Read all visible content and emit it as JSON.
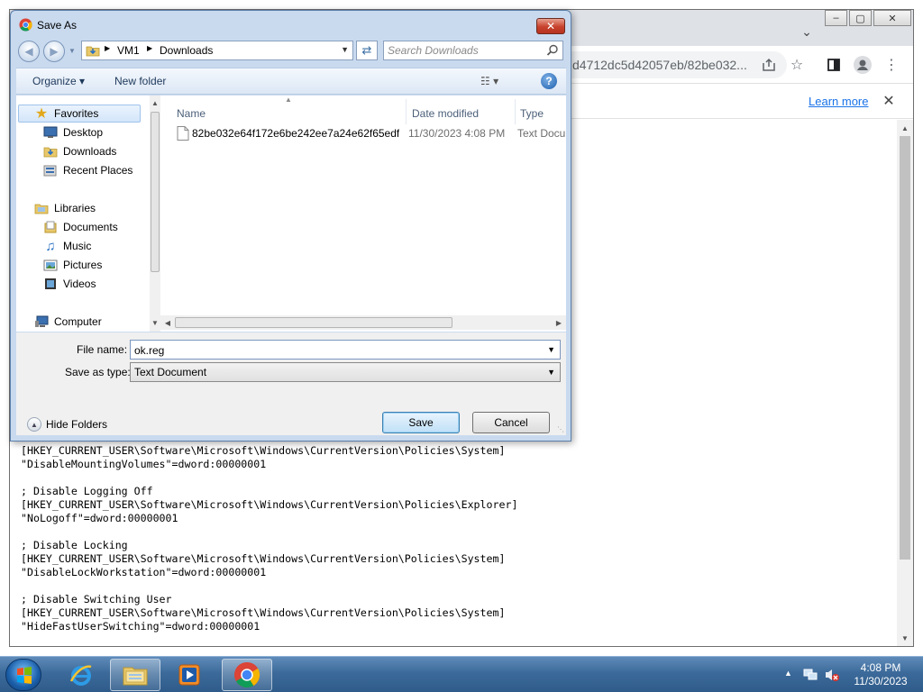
{
  "chrome": {
    "url_fragment": "d4712dc5d42057eb/82be032...",
    "learn_more": "Learn more",
    "close_symbol": "✕",
    "dropdown_symbol": "⌄"
  },
  "page": {
    "reg_lines": [
      "[HKEY_CURRENT_USER\\Software\\Microsoft\\Windows\\CurrentVersion\\Policies\\System]",
      "\"DisableMountingVolumes\"=dword:00000001",
      "",
      "; Disable Logging Off",
      "[HKEY_CURRENT_USER\\Software\\Microsoft\\Windows\\CurrentVersion\\Policies\\Explorer]",
      "\"NoLogoff\"=dword:00000001",
      "",
      "; Disable Locking",
      "[HKEY_CURRENT_USER\\Software\\Microsoft\\Windows\\CurrentVersion\\Policies\\System]",
      "\"DisableLockWorkstation\"=dword:00000001",
      "",
      "; Disable Switching User",
      "[HKEY_CURRENT_USER\\Software\\Microsoft\\Windows\\CurrentVersion\\Policies\\System]",
      "\"HideFastUserSwitching\"=dword:00000001"
    ]
  },
  "dialog": {
    "title": "Save As",
    "close_symbol": "✕",
    "breadcrumbs": [
      "VM1",
      "Downloads"
    ],
    "search_placeholder": "Search Downloads",
    "toolbar": {
      "organize": "Organize ▾",
      "new_folder": "New folder",
      "views": "☷ ▾",
      "help": "?"
    },
    "nav": {
      "favorites": "Favorites",
      "desktop": "Desktop",
      "downloads": "Downloads",
      "recent_places": "Recent Places",
      "libraries": "Libraries",
      "documents": "Documents",
      "music": "Music",
      "pictures": "Pictures",
      "videos": "Videos",
      "computer": "Computer"
    },
    "columns": [
      "Name",
      "Date modified",
      "Type"
    ],
    "files": [
      {
        "name": "82be032e64f172e6be242ee7a24e62f65edf...",
        "date": "11/30/2023 4:08 PM",
        "type": "Text Docu"
      }
    ],
    "file_name_label": "File name:",
    "file_name_value": "ok.reg",
    "save_as_type_label": "Save as type:",
    "save_as_type_value": "Text Document",
    "hide_folders": "Hide Folders",
    "save": "Save",
    "cancel": "Cancel"
  },
  "taskbar": {
    "time": "4:08 PM",
    "date": "11/30/2023"
  },
  "colors": {
    "dialog_frame": "#c9daef",
    "taskbar": "#3c6a9a",
    "link": "#1a73e8"
  }
}
